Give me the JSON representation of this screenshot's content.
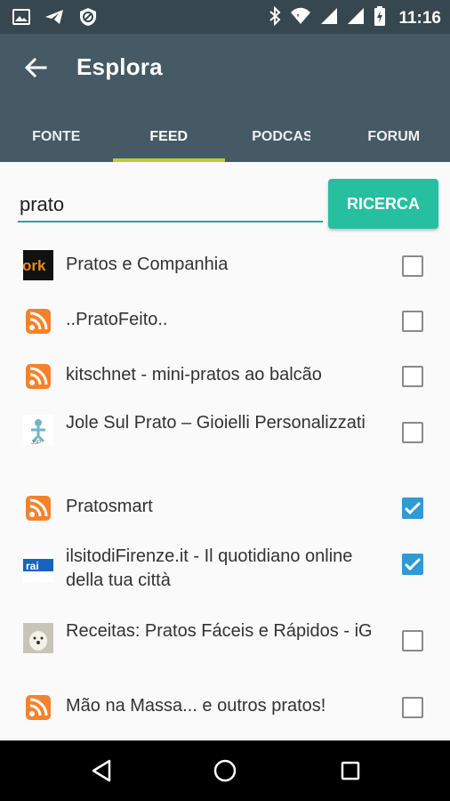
{
  "status_bar": {
    "time": "11:16",
    "left_icons": [
      "image-icon",
      "send-icon",
      "blocked-icon"
    ],
    "right_icons": [
      "bluetooth-icon",
      "wifi-icon",
      "signal-icon",
      "battery-icon"
    ]
  },
  "app_bar": {
    "title": "Esplora",
    "back_icon": "arrow-left-icon",
    "tabs": [
      {
        "label": "FONTE",
        "active": false
      },
      {
        "label": "FEED",
        "active": true
      },
      {
        "label": "PODCAST",
        "active": false
      },
      {
        "label": "FORUM",
        "active": false
      }
    ]
  },
  "search": {
    "value": "prato",
    "button_label": "RICERCA"
  },
  "results": [
    {
      "title": "Pratos e Companhia",
      "icon": "work-logo-icon",
      "checked": false
    },
    {
      "title": "..PratoFeito..",
      "icon": "rss-icon",
      "checked": false
    },
    {
      "title": "kitschnet - mini-pratos ao balcão",
      "icon": "rss-icon",
      "checked": false
    },
    {
      "title": "Jole Sul Prato – Gioielli Personalizzati",
      "icon": "jsp-logo-icon",
      "checked": false
    },
    {
      "title": "Pratosmart",
      "icon": "rss-icon",
      "checked": true
    },
    {
      "title": "ilsitodiFirenze.it - Il quotidiano online della tua città",
      "icon": "firenze-logo-icon",
      "checked": true
    },
    {
      "title": "Receitas: Pratos Fáceis e Rápidos - iG",
      "icon": "dog-photo-icon",
      "checked": false
    },
    {
      "title": "Mão na Massa... e outros pratos!",
      "icon": "rss-icon",
      "checked": false
    }
  ],
  "colors": {
    "status_bar": "#37474f",
    "app_bar": "#455a64",
    "accent": "#26bfa0",
    "tab_indicator": "#c0ca33",
    "checkbox_checked": "#2e9ad6",
    "rss_orange": "#f5822a"
  }
}
